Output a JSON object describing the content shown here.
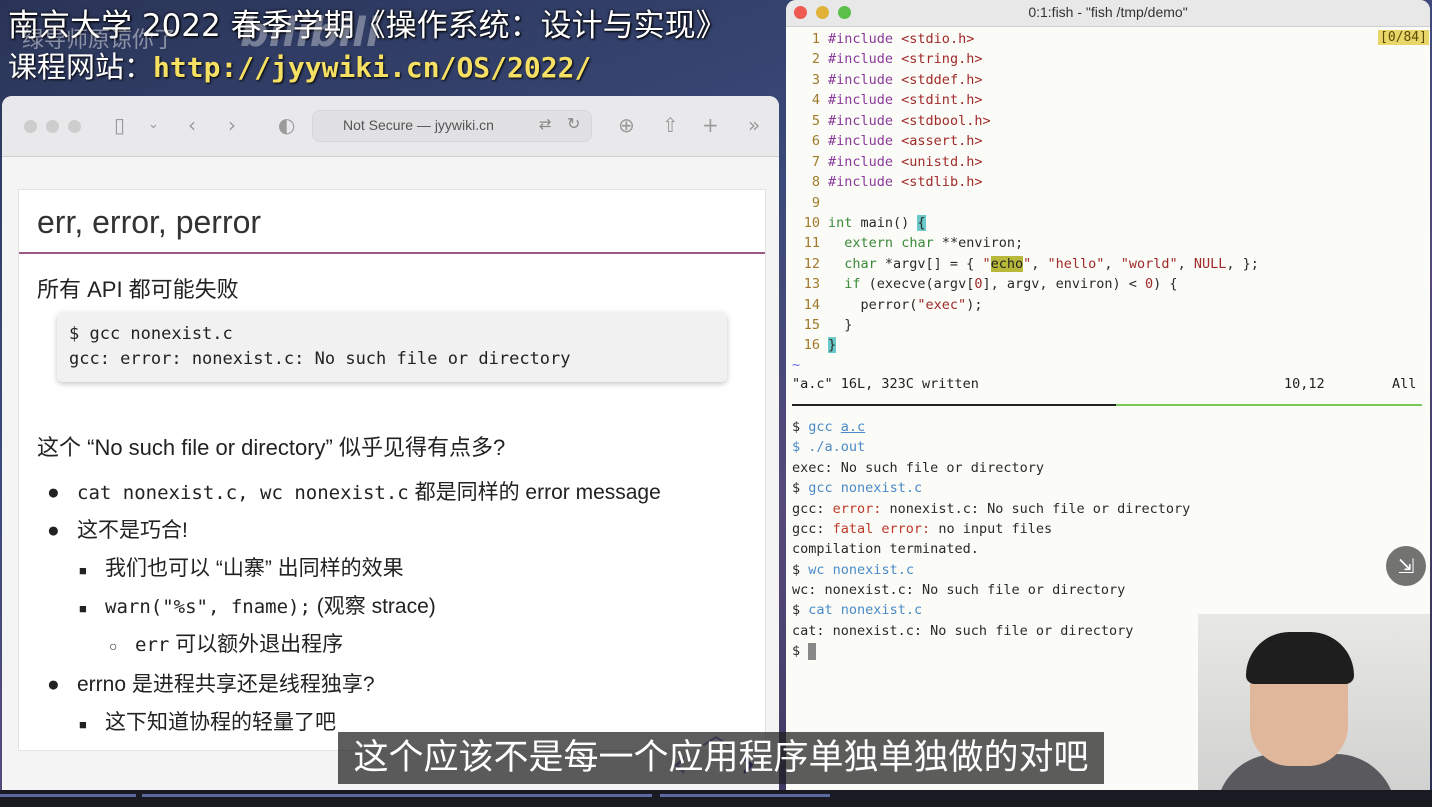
{
  "banner": {
    "title": "南京大学 2022 春季学期《操作系统：设计与实现》",
    "site_label": "课程网站：",
    "site_url": "http://jyywiki.cn/OS/2022/",
    "danmaku": "绿导师原谅你了",
    "watermark": "bilibili"
  },
  "browser": {
    "address": "Not Secure — jyywiki.cn",
    "icons": [
      "sidebar-icon",
      "chevron-down-icon",
      "back-icon",
      "forward-icon",
      "shield-icon",
      "translate-icon",
      "reload-icon",
      "download-icon",
      "share-icon",
      "new-tab-icon",
      "more-icon"
    ]
  },
  "slide": {
    "title": "err, error, perror",
    "p1": "所有 API 都可能失败",
    "code": [
      "$ gcc nonexist.c",
      "gcc: error: nonexist.c: No such file or directory"
    ],
    "p2": "这个 “No such file or directory” 似乎见得有点多?",
    "b1_code": "cat nonexist.c, wc nonexist.c",
    "b1_text": " 都是同样的 error message",
    "b2": "这不是巧合!",
    "b2a": "我们也可以 “山寨” 出同样的效果",
    "b2b_code": "warn(\"%s\", fname);",
    "b2b_text": " (观察 strace)",
    "b2b1_code": "err",
    "b2b1_text": " 可以额外退出程序",
    "b3": "errno 是进程共享还是线程独享?",
    "b3a": "这下知道协程的轻量了吧"
  },
  "terminal": {
    "title": "0:1:fish - \"fish /tmp/demo\"",
    "badge": "[0/84]",
    "status_file": "\"a.c\" 16L, 323C written",
    "status_pos": "10,12",
    "status_all": "All",
    "includes": [
      "<stdio.h>",
      "<string.h>",
      "<stddef.h>",
      "<stdint.h>",
      "<stdbool.h>",
      "<assert.h>",
      "<unistd.h>",
      "<stdlib.h>"
    ],
    "shell": {
      "l1_prompt": "$ ",
      "l1_cmd": "gcc",
      "l1_arg": "a.c",
      "l2": "$ ./a.out",
      "l3": "exec: No such file or directory",
      "l4_cmd": "gcc",
      "l4_arg": "nonexist.c",
      "l5_pre": "gcc: ",
      "l5_err": "error:",
      "l5_post": " nonexist.c: No such file or directory",
      "l6_pre": "gcc: ",
      "l6_err": "fatal error:",
      "l6_post": " no input files",
      "l7": "compilation terminated.",
      "l8_cmd": "wc",
      "l8_arg": "nonexist.c",
      "l9": "wc: nonexist.c: No such file or directory",
      "l10_cmd": "cat",
      "l10_arg": "nonexist.c",
      "l11": "cat: nonexist.c: No such file or directory",
      "l12": "$ "
    }
  },
  "subtitle": "这个应该不是每一个应用程序单独单独做的对吧",
  "colors": {
    "slide_rule": "#9a5a85",
    "url": "#f5e063",
    "term_green": "#7ac85a"
  }
}
